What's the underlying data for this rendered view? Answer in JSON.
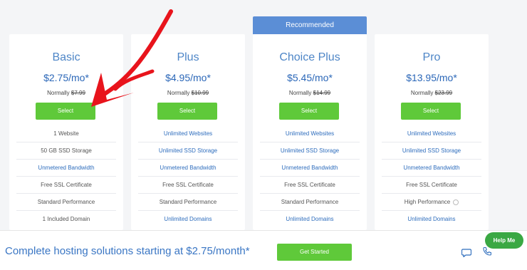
{
  "recommended_label": "Recommended",
  "plans": [
    {
      "name": "Basic",
      "price": "$2.75/mo*",
      "normally_label": "Normally ",
      "old_price": "$7.99",
      "select_label": "Select",
      "features": [
        {
          "text": "1 Website",
          "blue": false
        },
        {
          "text": "50 GB SSD Storage",
          "blue": false
        },
        {
          "text": "Unmetered Bandwidth",
          "blue": true
        },
        {
          "text": "Free SSL Certificate",
          "blue": false
        },
        {
          "text": "Standard Performance",
          "blue": false
        },
        {
          "text": "1 Included Domain",
          "blue": false
        }
      ]
    },
    {
      "name": "Plus",
      "price": "$4.95/mo*",
      "normally_label": "Normally ",
      "old_price": "$10.99",
      "select_label": "Select",
      "features": [
        {
          "text": "Unlimited Websites",
          "blue": true
        },
        {
          "text": "Unlimited SSD Storage",
          "blue": true
        },
        {
          "text": "Unmetered Bandwidth",
          "blue": true
        },
        {
          "text": "Free SSL Certificate",
          "blue": false
        },
        {
          "text": "Standard Performance",
          "blue": false
        },
        {
          "text": "Unlimited Domains",
          "blue": true
        }
      ]
    },
    {
      "name": "Choice Plus",
      "price": "$5.45/mo*",
      "normally_label": "Normally ",
      "old_price": "$14.99",
      "select_label": "Select",
      "features": [
        {
          "text": "Unlimited Websites",
          "blue": true
        },
        {
          "text": "Unlimited SSD Storage",
          "blue": true
        },
        {
          "text": "Unmetered Bandwidth",
          "blue": true
        },
        {
          "text": "Free SSL Certificate",
          "blue": false
        },
        {
          "text": "Standard Performance",
          "blue": false
        },
        {
          "text": "Unlimited Domains",
          "blue": true
        }
      ]
    },
    {
      "name": "Pro",
      "price": "$13.95/mo*",
      "normally_label": "Normally ",
      "old_price": "$23.99",
      "select_label": "Select",
      "features": [
        {
          "text": "Unlimited Websites",
          "blue": true
        },
        {
          "text": "Unlimited SSD Storage",
          "blue": true
        },
        {
          "text": "Unmetered Bandwidth",
          "blue": true
        },
        {
          "text": "Free SSL Certificate",
          "blue": false
        },
        {
          "text": "High Performance",
          "blue": false,
          "info": true
        },
        {
          "text": "Unlimited Domains",
          "blue": true
        }
      ]
    }
  ],
  "bottom_bar": {
    "promo_text": "Complete hosting solutions starting at $2.75/month*",
    "cta_label": "Get Started",
    "chat_icon": "chat-bubble-icon",
    "phone_icon": "phone-icon"
  },
  "help_label": "Help Me",
  "colors": {
    "accent_blue": "#2b67b8",
    "button_green": "#5fc93a",
    "recommended_bg": "#5b8ed6",
    "arrow_red": "#e8141c"
  }
}
